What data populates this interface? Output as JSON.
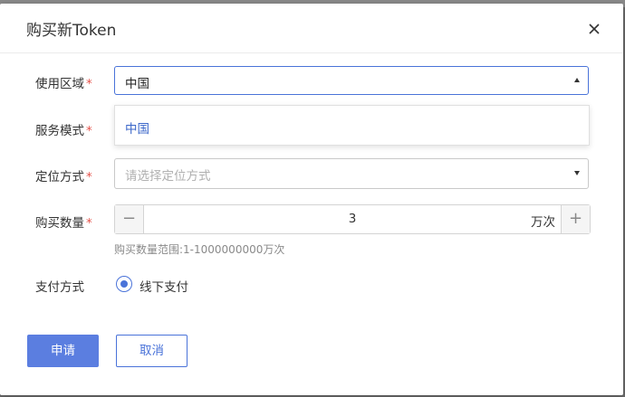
{
  "dialog": {
    "title": "购买新Token",
    "fields": {
      "region": {
        "label": "使用区域",
        "required_mark": "*",
        "value": "中国",
        "options": [
          "中国"
        ]
      },
      "service_mode": {
        "label": "服务模式",
        "required_mark": "*"
      },
      "positioning": {
        "label": "定位方式",
        "required_mark": "*",
        "placeholder": "请选择定位方式"
      },
      "quantity": {
        "label": "购买数量",
        "required_mark": "*",
        "value": "3",
        "unit": "万次",
        "minus": "−",
        "plus": "+",
        "hint": "购买数量范围:1-1000000000万次"
      },
      "payment": {
        "label": "支付方式",
        "option_label": "线下支付"
      }
    },
    "buttons": {
      "submit": "申请",
      "cancel": "取消"
    }
  },
  "colors": {
    "accent": "#4a73d9",
    "primary_button": "#5b7ee0",
    "required": "#e5534b"
  }
}
